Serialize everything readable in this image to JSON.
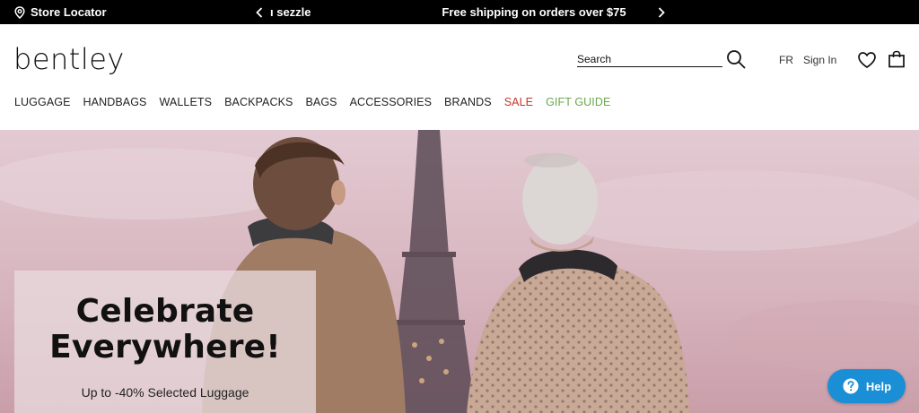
{
  "topbar": {
    "store_locator_label": "Store Locator",
    "promo_partial": "ı sezzle",
    "promo_main": "Free shipping on orders over $75"
  },
  "header": {
    "logo": "bentley",
    "search": {
      "placeholder": "Search",
      "value": ""
    },
    "language": "FR",
    "sign_in": "Sign In"
  },
  "nav": {
    "items": [
      {
        "label": "LUGGAGE"
      },
      {
        "label": "HANDBAGS"
      },
      {
        "label": "WALLETS"
      },
      {
        "label": "BACKPACKS"
      },
      {
        "label": "BAGS"
      },
      {
        "label": "ACCESSORIES"
      },
      {
        "label": "BRANDS"
      },
      {
        "label": "SALE"
      },
      {
        "label": "GIFT GUIDE"
      }
    ]
  },
  "hero": {
    "title_line1": "Celebrate",
    "title_line2": "Everywhere!",
    "subtitle": "Up to -40% Selected Luggage"
  },
  "help": {
    "label": "Help"
  },
  "colors": {
    "topbar_bg": "#000000",
    "sale": "#c0392b",
    "gift_guide": "#6aa84f",
    "help_button": "#1b8fd6"
  }
}
